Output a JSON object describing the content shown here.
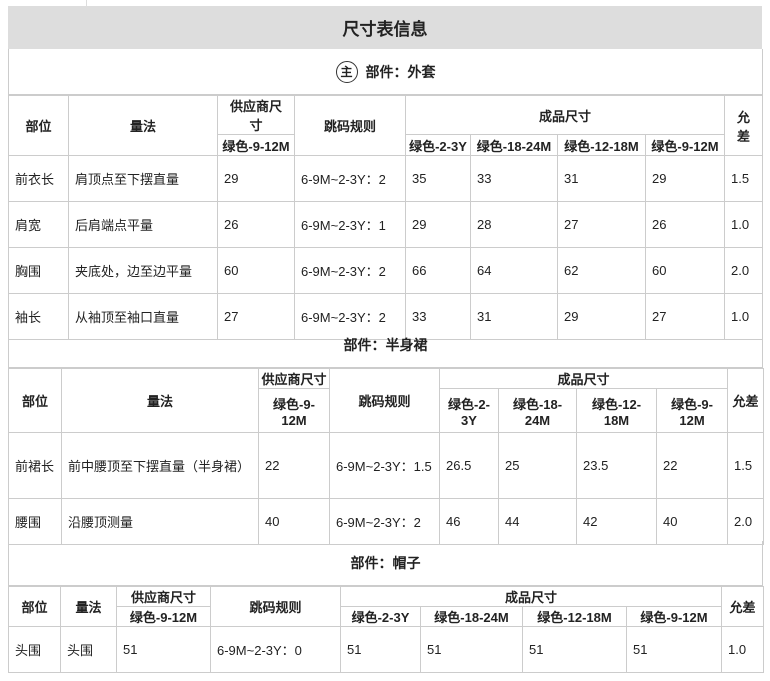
{
  "title": "尺寸表信息",
  "sections": [
    {
      "heading_mark": "主",
      "heading": "部件：外套",
      "headers": {
        "part": "部位",
        "method": "量法",
        "supplier": "供应商尺寸",
        "supplier_sub": "绿色-9-12M",
        "rule": "跳码规则",
        "finished": "成品尺寸",
        "sizes": [
          "绿色-2-3Y",
          "绿色-18-24M",
          "绿色-12-18M",
          "绿色-9-12M"
        ],
        "tol": "允差"
      },
      "rows": [
        {
          "part": "前衣长",
          "method": "肩顶点至下摆直量",
          "supplier": "29",
          "rule": "6-9M~2-3Y：2",
          "sizes": [
            "35",
            "33",
            "31",
            "29"
          ],
          "tol": "1.5"
        },
        {
          "part": "肩宽",
          "method": "后肩端点平量",
          "supplier": "26",
          "rule": "6-9M~2-3Y：1",
          "sizes": [
            "29",
            "28",
            "27",
            "26"
          ],
          "tol": "1.0"
        },
        {
          "part": "胸围",
          "method": "夹底处，边至边平量",
          "supplier": "60",
          "rule": "6-9M~2-3Y：2",
          "sizes": [
            "66",
            "64",
            "62",
            "60"
          ],
          "tol": "2.0"
        },
        {
          "part": "袖长",
          "method": "从袖顶至袖口直量",
          "supplier": "27",
          "rule": "6-9M~2-3Y：2",
          "sizes": [
            "33",
            "31",
            "29",
            "27"
          ],
          "tol": "1.0"
        }
      ]
    },
    {
      "heading": "部件：半身裙",
      "headers": {
        "part": "部位",
        "method": "量法",
        "supplier": "供应商尺寸",
        "supplier_sub": "绿色-9-12M",
        "rule": "跳码规则",
        "finished": "成品尺寸",
        "sizes": [
          "绿色-2-3Y",
          "绿色-18-24M",
          "绿色-12-18M",
          "绿色-9-12M"
        ],
        "tol": "允差"
      },
      "rows": [
        {
          "part": "前裙长",
          "method": "前中腰顶至下摆直量（半身裙）",
          "supplier": "22",
          "rule": "6-9M~2-3Y：1.5",
          "sizes": [
            "26.5",
            "25",
            "23.5",
            "22"
          ],
          "tol": "1.5"
        },
        {
          "part": "腰围",
          "method": "沿腰顶测量",
          "supplier": "40",
          "rule": "6-9M~2-3Y：2",
          "sizes": [
            "46",
            "44",
            "42",
            "40"
          ],
          "tol": "2.0"
        }
      ]
    },
    {
      "heading": "部件：帽子",
      "headers": {
        "part": "部位",
        "method": "量法",
        "supplier": "供应商尺寸",
        "supplier_sub": "绿色-9-12M",
        "rule": "跳码规则",
        "finished": "成品尺寸",
        "sizes": [
          "绿色-2-3Y",
          "绿色-18-24M",
          "绿色-12-18M",
          "绿色-9-12M"
        ],
        "tol": "允差"
      },
      "rows": [
        {
          "part": "头围",
          "method": "头围",
          "supplier": "51",
          "rule": "6-9M~2-3Y：0",
          "sizes": [
            "51",
            "51",
            "51",
            "51"
          ],
          "tol": "1.0"
        }
      ]
    }
  ]
}
